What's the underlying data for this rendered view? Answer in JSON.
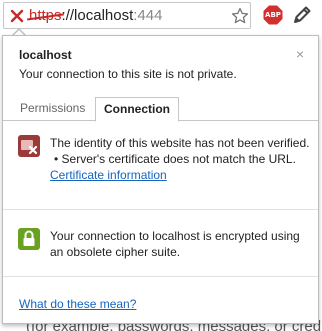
{
  "omnibox": {
    "scheme": "https",
    "separator": "://",
    "host": "localhost",
    "port": ":444",
    "lock_icon": "broken-lock-icon",
    "star_icon": "star-icon",
    "abp_icon": "adblock-plus-icon",
    "abp_label": "ABP",
    "pencil_icon": "pencil-icon"
  },
  "popup": {
    "site_name": "localhost",
    "site_status": "Your connection to this site is not private.",
    "close_label": "×",
    "tabs": [
      {
        "label": "Permissions",
        "selected": false
      },
      {
        "label": "Connection",
        "selected": true
      }
    ],
    "identity": {
      "icon": "identity-error-icon",
      "text": "The identity of this website has not been verified.",
      "bullet": "• Server's certificate does not match the URL.",
      "link": "Certificate information"
    },
    "encryption": {
      "icon": "encryption-lock-icon",
      "text": "Your connection to localhost is encrypted using an obsolete cipher suite."
    },
    "help_link": "What do these mean?"
  },
  "background": {
    "partial_text": "(for example, passwords, messages, or credit"
  },
  "colors": {
    "error_red": "#c62828",
    "link_blue": "#1565c0",
    "lock_green": "#6aa121",
    "identity_red": "#9c3a3a"
  }
}
